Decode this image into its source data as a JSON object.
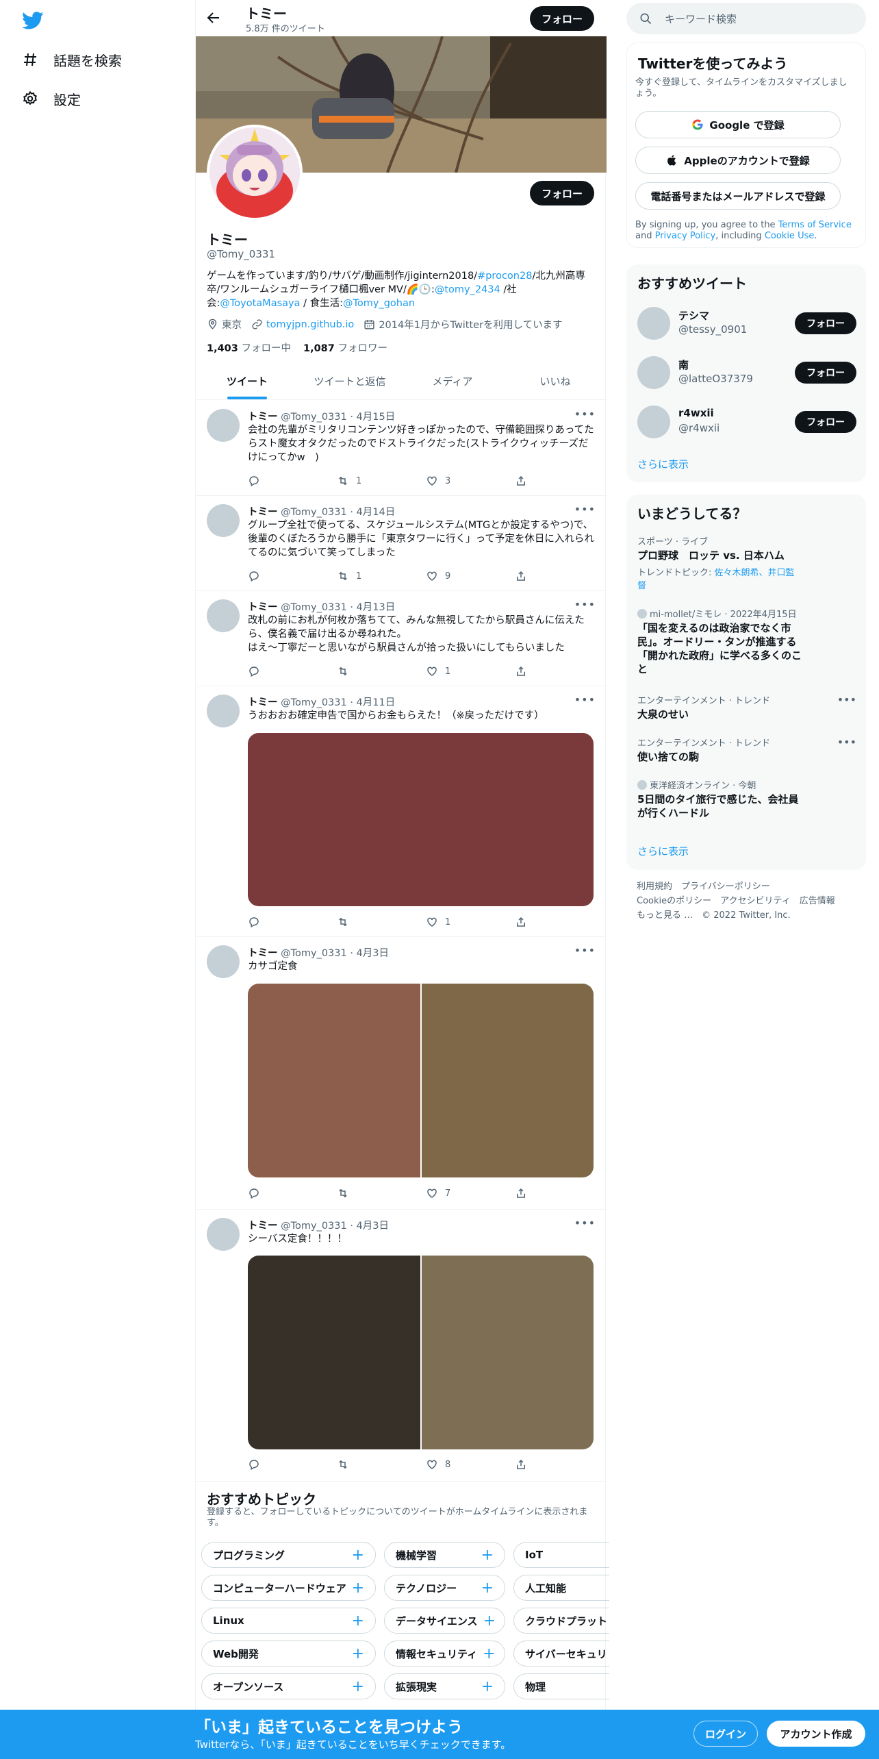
{
  "nav": {
    "explore_label": "話題を検索",
    "settings_label": "設定"
  },
  "profile": {
    "name": "トミー",
    "tweet_count": "5.8万 件のツイート",
    "handle": "@Tomy_0331",
    "follow_label": "フォロー",
    "bio_1": "ゲームを作っています/釣り/サバゲ/動画制作/jigintern2018/",
    "bio_hashtag": "#procon28",
    "bio_2": "/北九州高専卒/ワンルームシュガーライフ樋口楓ver MV/🌈🕒:",
    "bio_mention1": "@tomy_2434",
    "bio_3": " /社会:",
    "bio_mention2": "@ToyotaMasaya",
    "bio_4": " / 食生活:",
    "bio_mention3": "@Tomy_gohan",
    "location": "東京",
    "website": "tomyjpn.github.io",
    "joined": "2014年1月からTwitterを利用しています",
    "following_count": "1,403",
    "following_label": "フォロー中",
    "followers_count": "1,087",
    "followers_label": "フォロワー"
  },
  "tabs": [
    "ツイート",
    "ツイートと返信",
    "メディア",
    "いいね"
  ],
  "tweets": [
    {
      "name": "トミー",
      "meta": "@Tomy_0331 · 4月15日",
      "text": "会社の先輩がミリタリコンテンツ好きっぽかったので、守備範囲探りあってたらスト魔女オタクだったのでドストライクだった(ストライクウィッチーズだけにってかw　)",
      "retweets": "1",
      "likes": "3"
    },
    {
      "name": "トミー",
      "meta": "@Tomy_0331 · 4月14日",
      "text": "グループ全社で使ってる、スケジュールシステム(MTGとか設定するやつ)で、後輩のくぼたろうから勝手に「東京タワーに行く」って予定を休日に入れられてるのに気づいて笑ってしまった",
      "retweets": "1",
      "likes": "9"
    },
    {
      "name": "トミー",
      "meta": "@Tomy_0331 · 4月13日",
      "text": "改札の前にお札が何枚か落ちてて、みんな無視してたから駅員さんに伝えたら、僕名義で届け出るか尋ねれた。\nはえ〜丁寧だーと思いながら駅員さんが拾った扱いにしてもらいました",
      "retweets": "",
      "likes": "1"
    },
    {
      "name": "トミー",
      "meta": "@Tomy_0331 · 4月11日",
      "text": "うおおおお確定申告で国からお金もらえた！（※戻っただけです）",
      "retweets": "",
      "likes": "1"
    },
    {
      "name": "トミー",
      "meta": "@Tomy_0331 · 4月3日",
      "text": "カサゴ定食",
      "retweets": "",
      "likes": "7"
    },
    {
      "name": "トミー",
      "meta": "@Tomy_0331 · 4月3日",
      "text": "シーバス定食！！！！",
      "retweets": "",
      "likes": "8"
    }
  ],
  "topics": {
    "title": "おすすめトピック",
    "subtitle": "登録すると、フォローしているトピックについてのツイートがホームタイムラインに表示されます。",
    "rows": [
      [
        "プログラミング",
        "機械学習",
        "IoT"
      ],
      [
        "コンピューターハードウェア",
        "テクノロジー",
        "人工知能"
      ],
      [
        "Linux",
        "データサイエンス",
        "クラウドプラット"
      ],
      [
        "Web開発",
        "情報セキュリティ",
        "サイバーセキュリ"
      ],
      [
        "オープンソース",
        "拡張現実",
        "物理"
      ]
    ]
  },
  "search": {
    "placeholder": "キーワード検索"
  },
  "signup": {
    "title": "Twitterを使ってみよう",
    "subtitle": "今すぐ登録して、タイムラインをカスタマイズしましょう。",
    "google": "Google で登録",
    "apple": "Appleのアカウントで登録",
    "phone": "電話番号またはメールアドレスで登録",
    "tos_1": "By signing up, you agree to the ",
    "tos_link1": "Terms of Service",
    "tos_2": " and ",
    "tos_link2": "Privacy Policy",
    "tos_3": ", including ",
    "tos_link3": "Cookie Use",
    "tos_4": "."
  },
  "recommended": {
    "title": "おすすめツイート",
    "users": [
      {
        "name": "テシマ",
        "handle": "@tessy_0901"
      },
      {
        "name": "南",
        "handle": "@latteO37379"
      },
      {
        "name": "r4wxii",
        "handle": "@r4wxii"
      }
    ],
    "follow_label": "フォロー",
    "show_more": "さらに表示"
  },
  "trends": {
    "title": "いまどうしてる？",
    "items": [
      {
        "cat": "スポーツ · ライブ",
        "title": "プロ野球　ロッテ vs. 日本ハム",
        "extra_label": "トレンドトピック: ",
        "extra_links": "佐々木朗希、井口監督"
      },
      {
        "cat": "mi-mollet/ミモレ · 2022年4月15日",
        "title": "「国を変えるのは政治家でなく市民」。オードリー・タンが推進する「開かれた政府」に学べる多くのこと"
      },
      {
        "cat": "エンターテインメント · トレンド",
        "title": "大泉のせい"
      },
      {
        "cat": "エンターテインメント · トレンド",
        "title": "使い捨ての駒"
      },
      {
        "cat": "東洋経済オンライン · 今朝",
        "title": "5日間のタイ旅行で感じた、会社員が行くハードル"
      }
    ],
    "show_more": "さらに表示"
  },
  "footer": {
    "line1": "利用規約　プライバシーポリシー",
    "line2": "Cookieのポリシー　アクセシビリティ　広告情報",
    "line3": "もっと見る …　© 2022 Twitter, Inc."
  },
  "bottom_bar": {
    "title": "「いま」起きていることを見つけよう",
    "subtitle": "Twitterなら、「いま」起きていることをいち早くチェックできます。",
    "login": "ログイン",
    "signup": "アカウント作成"
  },
  "colors": {
    "accent": "#1d9bf0",
    "media_1": "#7a393b",
    "media_2a": "#8d5e4b",
    "media_2b": "#7e6847",
    "media_3a": "#363028",
    "media_3b": "#7d6e54"
  }
}
